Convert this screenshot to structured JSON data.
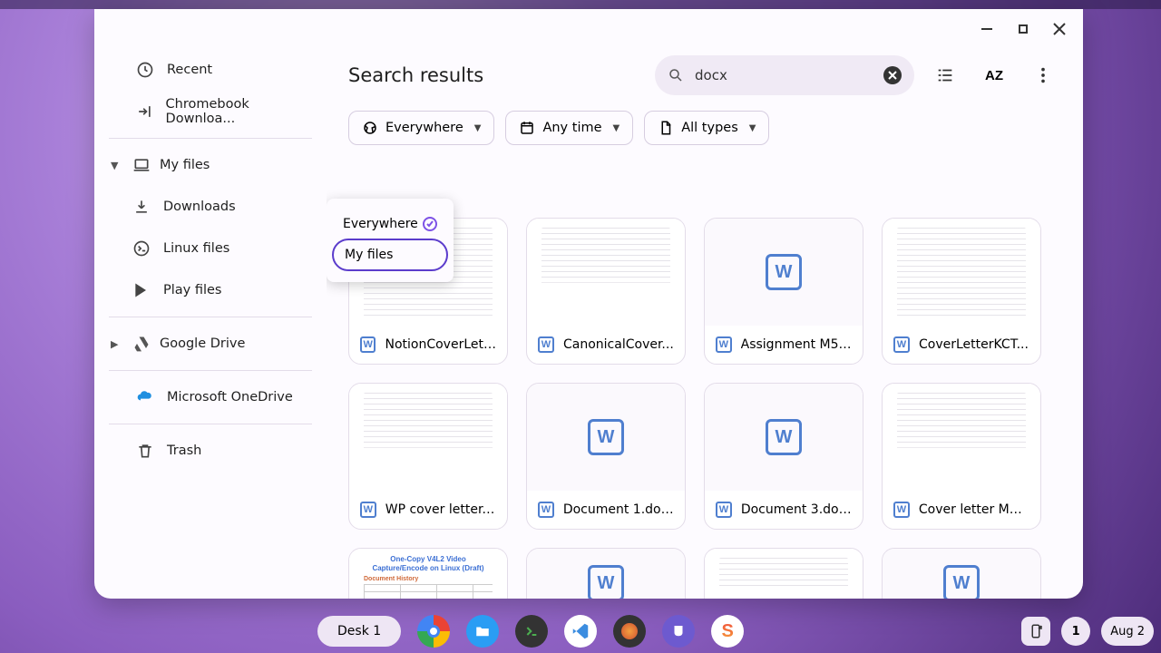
{
  "window": {
    "minimize": "",
    "maximize": "",
    "close": ""
  },
  "sidebar": {
    "recent": "Recent",
    "chromebook_downloads": "Chromebook Downloa...",
    "my_files": "My files",
    "downloads": "Downloads",
    "linux": "Linux files",
    "play": "Play files",
    "drive": "Google Drive",
    "onedrive": "Microsoft OneDrive",
    "trash": "Trash"
  },
  "header": {
    "title": "Search results",
    "search_value": "docx"
  },
  "filters": {
    "location": "Everywhere",
    "time": "Any time",
    "type": "All types"
  },
  "location_dropdown": {
    "everywhere": "Everywhere",
    "my_files": "My files"
  },
  "files": [
    {
      "name": "NotionCoverLett...",
      "thumb": "doc"
    },
    {
      "name": "CanonicalCover...",
      "thumb": "doc"
    },
    {
      "name": "Assignment M5....",
      "thumb": "icon"
    },
    {
      "name": "CoverLetterKCT...",
      "thumb": "doc"
    },
    {
      "name": "WP cover letter....",
      "thumb": "doc"
    },
    {
      "name": "Document 1.docx",
      "thumb": "icon"
    },
    {
      "name": "Document 3.docx",
      "thumb": "icon"
    },
    {
      "name": "Cover letter MC...",
      "thumb": "doc"
    },
    {
      "name": "",
      "thumb": "docblue"
    },
    {
      "name": "",
      "thumb": "icon"
    },
    {
      "name": "",
      "thumb": "doc"
    },
    {
      "name": "",
      "thumb": "icon"
    }
  ],
  "shelf": {
    "desk": "Desk 1",
    "notif_count": "1",
    "date": "Aug 2"
  }
}
